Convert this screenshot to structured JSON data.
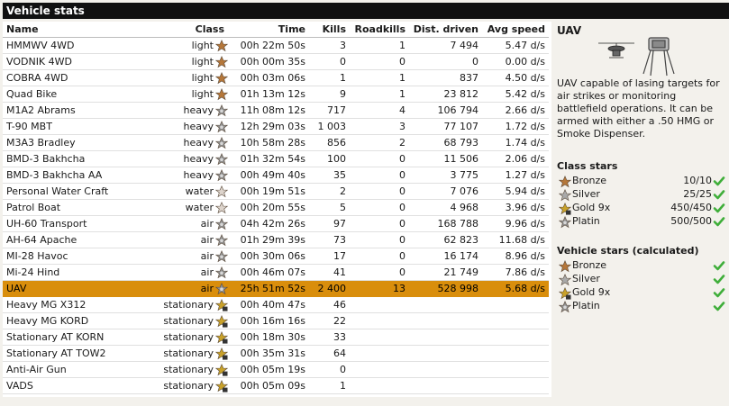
{
  "title": "Vehicle stats",
  "columns": [
    "Name",
    "Class",
    "Time",
    "Kills",
    "Roadkills",
    "Dist. driven",
    "Avg speed"
  ],
  "rows": [
    {
      "name": "HMMWV 4WD",
      "class": "light",
      "time": "00h 22m 50s",
      "kills": "3",
      "roadkills": "1",
      "dist": "7 494",
      "speed": "5.47 d/s",
      "star": "bronze",
      "selected": false
    },
    {
      "name": "VODNIK 4WD",
      "class": "light",
      "time": "00h 00m 35s",
      "kills": "0",
      "roadkills": "0",
      "dist": "0",
      "speed": "0.00 d/s",
      "star": "bronze",
      "selected": false
    },
    {
      "name": "COBRA 4WD",
      "class": "light",
      "time": "00h 03m 06s",
      "kills": "1",
      "roadkills": "1",
      "dist": "837",
      "speed": "4.50 d/s",
      "star": "bronze",
      "selected": false
    },
    {
      "name": "Quad Bike",
      "class": "light",
      "time": "01h 13m 12s",
      "kills": "9",
      "roadkills": "1",
      "dist": "23 812",
      "speed": "5.42 d/s",
      "star": "bronze",
      "selected": false
    },
    {
      "name": "M1A2 Abrams",
      "class": "heavy",
      "time": "11h 08m 12s",
      "kills": "717",
      "roadkills": "4",
      "dist": "106 794",
      "speed": "2.66 d/s",
      "star": "platin",
      "selected": false
    },
    {
      "name": "T-90 MBT",
      "class": "heavy",
      "time": "12h 29m 03s",
      "kills": "1 003",
      "roadkills": "3",
      "dist": "77 107",
      "speed": "1.72 d/s",
      "star": "platin",
      "selected": false
    },
    {
      "name": "M3A3 Bradley",
      "class": "heavy",
      "time": "10h 58m 28s",
      "kills": "856",
      "roadkills": "2",
      "dist": "68 793",
      "speed": "1.74 d/s",
      "star": "platin",
      "selected": false
    },
    {
      "name": "BMD-3 Bakhcha",
      "class": "heavy",
      "time": "01h 32m 54s",
      "kills": "100",
      "roadkills": "0",
      "dist": "11 506",
      "speed": "2.06 d/s",
      "star": "platin",
      "selected": false
    },
    {
      "name": "BMD-3 Bakhcha AA",
      "class": "heavy",
      "time": "00h 49m 40s",
      "kills": "35",
      "roadkills": "0",
      "dist": "3 775",
      "speed": "1.27 d/s",
      "star": "platin",
      "selected": false
    },
    {
      "name": "Personal Water Craft",
      "class": "water",
      "time": "00h 19m 51s",
      "kills": "2",
      "roadkills": "0",
      "dist": "7 076",
      "speed": "5.94 d/s",
      "star": "none",
      "selected": false
    },
    {
      "name": "Patrol Boat",
      "class": "water",
      "time": "00h 20m 55s",
      "kills": "5",
      "roadkills": "0",
      "dist": "4 968",
      "speed": "3.96 d/s",
      "star": "none",
      "selected": false
    },
    {
      "name": "UH-60 Transport",
      "class": "air",
      "time": "04h 42m 26s",
      "kills": "97",
      "roadkills": "0",
      "dist": "168 788",
      "speed": "9.96 d/s",
      "star": "platin",
      "selected": false
    },
    {
      "name": "AH-64 Apache",
      "class": "air",
      "time": "01h 29m 39s",
      "kills": "73",
      "roadkills": "0",
      "dist": "62 823",
      "speed": "11.68 d/s",
      "star": "platin",
      "selected": false
    },
    {
      "name": "MI-28 Havoc",
      "class": "air",
      "time": "00h 30m 06s",
      "kills": "17",
      "roadkills": "0",
      "dist": "16 174",
      "speed": "8.96 d/s",
      "star": "platin",
      "selected": false
    },
    {
      "name": "Mi-24 Hind",
      "class": "air",
      "time": "00h 46m 07s",
      "kills": "41",
      "roadkills": "0",
      "dist": "21 749",
      "speed": "7.86 d/s",
      "star": "platin",
      "selected": false
    },
    {
      "name": "UAV",
      "class": "air",
      "time": "25h 51m 52s",
      "kills": "2 400",
      "roadkills": "13",
      "dist": "528 998",
      "speed": "5.68 d/s",
      "star": "platin",
      "selected": true
    },
    {
      "name": "Heavy MG X312",
      "class": "stationary",
      "time": "00h 40m 47s",
      "kills": "46",
      "roadkills": "",
      "dist": "",
      "speed": "",
      "star": "gold",
      "selected": false
    },
    {
      "name": "Heavy MG KORD",
      "class": "stationary",
      "time": "00h 16m 16s",
      "kills": "22",
      "roadkills": "",
      "dist": "",
      "speed": "",
      "star": "gold",
      "selected": false
    },
    {
      "name": "Stationary AT KORN",
      "class": "stationary",
      "time": "00h 18m 30s",
      "kills": "33",
      "roadkills": "",
      "dist": "",
      "speed": "",
      "star": "gold",
      "selected": false
    },
    {
      "name": "Stationary AT TOW2",
      "class": "stationary",
      "time": "00h 35m 31s",
      "kills": "64",
      "roadkills": "",
      "dist": "",
      "speed": "",
      "star": "gold",
      "selected": false
    },
    {
      "name": "Anti-Air Gun",
      "class": "stationary",
      "time": "00h 05m 19s",
      "kills": "0",
      "roadkills": "",
      "dist": "",
      "speed": "",
      "star": "gold",
      "selected": false
    },
    {
      "name": "VADS",
      "class": "stationary",
      "time": "00h 05m 09s",
      "kills": "1",
      "roadkills": "",
      "dist": "",
      "speed": "",
      "star": "gold",
      "selected": false
    }
  ],
  "detail": {
    "title": "UAV",
    "description": "UAV capable of lasing targets for air strikes or monitoring battlefield operations. It can be armed with either a .50 HMG or Smoke Dispenser.",
    "class_stars_heading": "Class stars",
    "class_stars": [
      {
        "label": "Bronze",
        "value": "10/10",
        "star": "bronze"
      },
      {
        "label": "Silver",
        "value": "25/25",
        "star": "silver"
      },
      {
        "label": "Gold 9x",
        "value": "450/450",
        "star": "gold"
      },
      {
        "label": "Platin",
        "value": "500/500",
        "star": "platin"
      }
    ],
    "vehicle_stars_heading": "Vehicle stars (calculated)",
    "vehicle_stars": [
      {
        "label": "Bronze",
        "star": "bronze"
      },
      {
        "label": "Silver",
        "star": "silver"
      },
      {
        "label": "Gold 9x",
        "star": "gold"
      },
      {
        "label": "Platin",
        "star": "platin"
      }
    ]
  },
  "colors": {
    "bronze": "#b5773a",
    "silver": "#a9a9a9",
    "gold": "#c8a12a",
    "platin": "#8f8f8f",
    "none": "#ddd4cc",
    "check": "#3fae3a",
    "highlight": "#d98e0c"
  }
}
